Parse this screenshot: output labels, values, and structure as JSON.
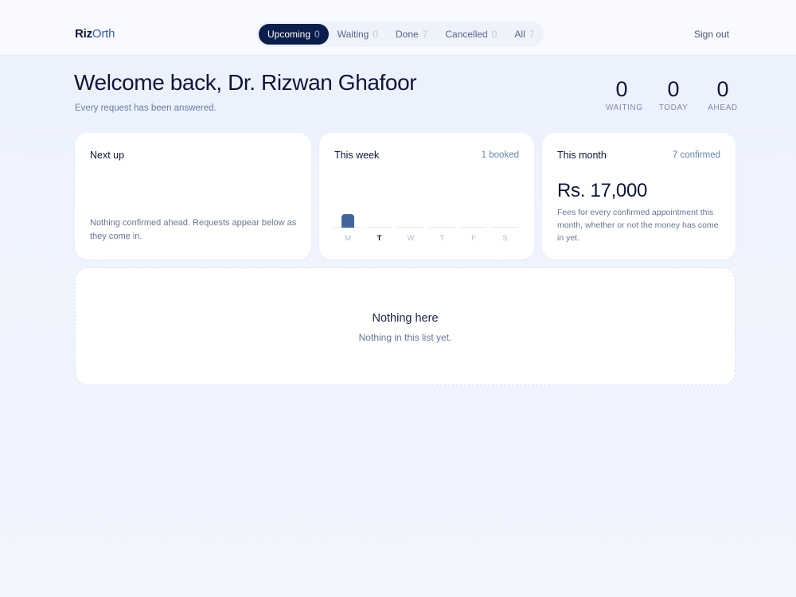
{
  "brand": {
    "part1": "Riz",
    "part2": "Orth"
  },
  "tabs": [
    {
      "label": "Upcoming",
      "count": "0",
      "active": true
    },
    {
      "label": "Waiting",
      "count": "0",
      "active": false
    },
    {
      "label": "Done",
      "count": "7",
      "active": false
    },
    {
      "label": "Cancelled",
      "count": "0",
      "active": false
    },
    {
      "label": "All",
      "count": "7",
      "active": false
    }
  ],
  "header": {
    "signout": "Sign out"
  },
  "welcome": {
    "title": "Welcome back, Dr. Rizwan Ghafoor",
    "subtitle": "Every request has been answered."
  },
  "stats": [
    {
      "value": "0",
      "label": "WAITING"
    },
    {
      "value": "0",
      "label": "TODAY"
    },
    {
      "value": "0",
      "label": "AHEAD"
    }
  ],
  "next_up": {
    "title": "Next up",
    "text": "Nothing confirmed ahead. Requests appear below as they come in."
  },
  "this_week": {
    "title": "This week",
    "meta": "1 booked",
    "days": [
      "M",
      "T",
      "W",
      "T",
      "F",
      "S"
    ],
    "bookings": [
      1,
      0,
      0,
      0,
      0,
      0
    ],
    "today_index": 1
  },
  "this_month": {
    "title": "This month",
    "meta": "7 confirmed",
    "amount": "Rs. 17,000",
    "text": "Fees for every confirmed appointment this month, whether or not the money has come in yet."
  },
  "empty_state": {
    "title": "Nothing here",
    "subtitle": "Nothing in this list yet."
  },
  "colors": {
    "accent": "#0b1d4a",
    "bar": "#44649c",
    "background": "#eef3fd"
  }
}
